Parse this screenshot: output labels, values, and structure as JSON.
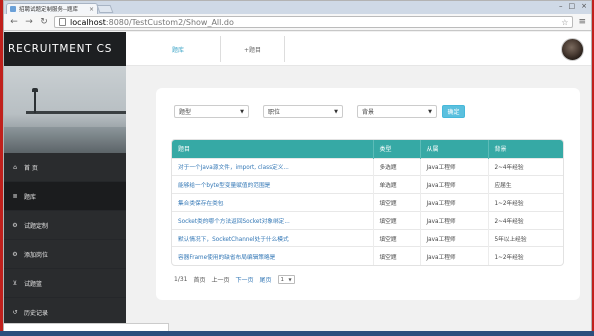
{
  "browser": {
    "tab_title": "招聘试题定制服务--题库",
    "url_host": "localhost",
    "url_path": ":8080/TestCustom2/Show_All.do"
  },
  "sidebar": {
    "brand": "RECRUITMENT CS",
    "items": [
      {
        "icon": "home-icon",
        "glyph": "⌂",
        "label": "首 页"
      },
      {
        "icon": "database-icon",
        "glyph": "≣",
        "label": "题库"
      },
      {
        "icon": "gear-icon",
        "glyph": "⚙",
        "label": "试题定制"
      },
      {
        "icon": "gears-icon",
        "glyph": "⚙",
        "label": "添加岗位"
      },
      {
        "icon": "cart-icon",
        "glyph": "⊻",
        "label": "试题篮"
      },
      {
        "icon": "history-icon",
        "glyph": "↺",
        "label": "历史记录"
      }
    ]
  },
  "topbar": {
    "tabs": [
      "题库",
      "+题目"
    ]
  },
  "filters": {
    "type": "题型",
    "position": "职位",
    "background": "背景",
    "confirm": "确定"
  },
  "table": {
    "headers": [
      "题目",
      "类型",
      "从属",
      "背景"
    ],
    "rows": [
      [
        "对于一个Java源文件，import, class定义...",
        "多选题",
        "Java工程师",
        "2~4年经验"
      ],
      [
        "能够给一个byte型变量赋值的范围是",
        "单选题",
        "Java工程师",
        "应届生"
      ],
      [
        "集合类保存在类包",
        "填空题",
        "Java工程师",
        "1~2年经验"
      ],
      [
        "Socket类的哪个方法返回Socket对象绑定...",
        "填空题",
        "Java工程师",
        "2~4年经验"
      ],
      [
        "默认情况下，SocketChannel处于什么模式",
        "填空题",
        "Java工程师",
        "5年以上经验"
      ],
      [
        "容器Frame使用的缺省布局编辑策略是",
        "填空题",
        "Java工程师",
        "1~2年经验"
      ]
    ]
  },
  "pager": {
    "page": "1/31",
    "first": "首页",
    "prev": "上一页",
    "next": "下一页",
    "last": "尾页",
    "select_value": "1"
  }
}
